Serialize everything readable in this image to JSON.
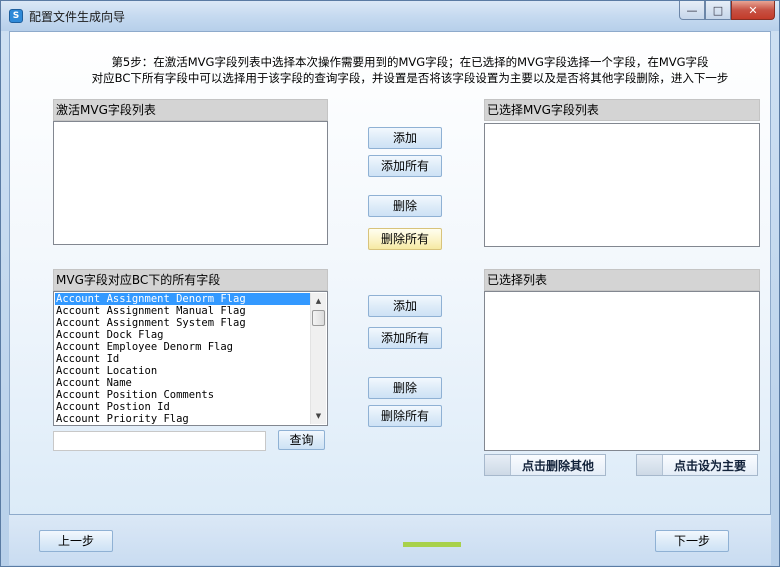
{
  "window": {
    "title": "配置文件生成向导",
    "app_icon_glyph": "S",
    "buttons": [
      "—",
      "□",
      "✕"
    ]
  },
  "instructions": {
    "line1": "第5步：在激活MVG字段列表中选择本次操作需要用到的MVG字段；在已选择的MVG字段选择一个字段，在MVG字段",
    "line2": "对应BC下所有字段中可以选择用于该字段的查询字段，并设置是否将该字段设置为主要以及是否将其他字段删除，进入下一步"
  },
  "active_mvg": {
    "header": "激活MVG字段列表",
    "items": []
  },
  "selected_mvg": {
    "header": "已选择MVG字段列表",
    "items": []
  },
  "top_buttons": {
    "add": "添加",
    "add_all": "添加所有",
    "remove": "删除",
    "remove_all": "删除所有"
  },
  "bc_fields": {
    "header": "MVG字段对应BC下的所有字段",
    "items": [
      "Account Assignment Denorm Flag",
      "Account Assignment Manual Flag",
      "Account Assignment System Flag",
      "Account Dock Flag",
      "Account Employee Denorm Flag",
      "Account Id",
      "Account Location",
      "Account Name",
      "Account Position Comments",
      "Account Postion Id",
      "Account Priority Flag"
    ],
    "selected_index": 0,
    "search_value": "",
    "search_button": "查询"
  },
  "selected_list": {
    "header": "已选择列表",
    "items": []
  },
  "bottom_buttons": {
    "add": "添加",
    "add_all": "添加所有",
    "remove": "删除",
    "remove_all": "删除所有"
  },
  "actions": {
    "delete_others": "点击删除其他",
    "set_primary": "点击设为主要"
  },
  "nav": {
    "prev": "上一步",
    "next": "下一步"
  },
  "colors": {
    "accent": "#3399ff",
    "progress": "#a8d14a",
    "hot_button": "#fbf3c4"
  }
}
